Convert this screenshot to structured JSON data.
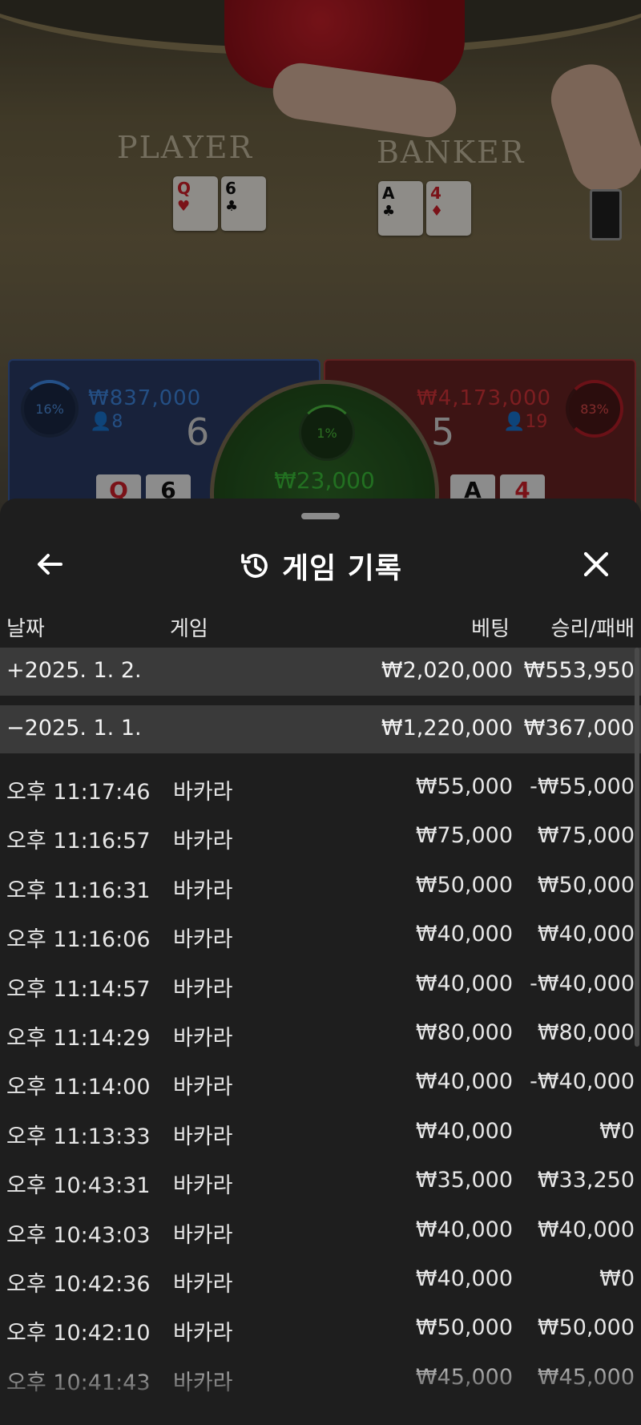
{
  "stage": {
    "player_label": "PLAYER",
    "banker_label": "BANKER",
    "player_cards": [
      {
        "rank": "Q",
        "suit": "♥",
        "color": "red"
      },
      {
        "rank": "6",
        "suit": "♣",
        "color": "black"
      }
    ],
    "banker_cards": [
      {
        "rank": "A",
        "suit": "♣",
        "color": "black"
      },
      {
        "rank": "4",
        "suit": "♦",
        "color": "red"
      }
    ],
    "player": {
      "percent": "16%",
      "amount": "₩837,000",
      "count": "8",
      "score": "6",
      "mini": [
        "Q",
        "6"
      ]
    },
    "banker": {
      "percent": "83%",
      "amount": "₩4,173,000",
      "count": "19",
      "score": "5",
      "mini": [
        "A",
        "4"
      ]
    },
    "tie": {
      "percent": "1%",
      "amount": "₩23,000"
    },
    "colors": {
      "player": "#3e8be8",
      "banker": "#d82a32",
      "tie": "#3cc23a"
    }
  },
  "sheet": {
    "title": "게임 기록",
    "title_icon": "history-icon",
    "back_icon": "arrow-left-icon",
    "close_icon": "close-icon",
    "columns": {
      "date": "날짜",
      "game": "게임",
      "bet": "베팅",
      "result": "승리/패배"
    },
    "days": [
      {
        "label": "+2025. 1. 2.",
        "bet": "₩2,020,000",
        "result": "₩553,950"
      },
      {
        "label": "−2025. 1. 1.",
        "bet": "₩1,220,000",
        "result": "₩367,000"
      }
    ],
    "rows": [
      {
        "time": "오후 11:17:46",
        "game": "바카라",
        "bet": "₩55,000",
        "result": "-₩55,000"
      },
      {
        "time": "오후 11:16:57",
        "game": "바카라",
        "bet": "₩75,000",
        "result": "₩75,000"
      },
      {
        "time": "오후 11:16:31",
        "game": "바카라",
        "bet": "₩50,000",
        "result": "₩50,000"
      },
      {
        "time": "오후 11:16:06",
        "game": "바카라",
        "bet": "₩40,000",
        "result": "₩40,000"
      },
      {
        "time": "오후 11:14:57",
        "game": "바카라",
        "bet": "₩40,000",
        "result": "-₩40,000"
      },
      {
        "time": "오후 11:14:29",
        "game": "바카라",
        "bet": "₩80,000",
        "result": "₩80,000"
      },
      {
        "time": "오후 11:14:00",
        "game": "바카라",
        "bet": "₩40,000",
        "result": "-₩40,000"
      },
      {
        "time": "오후 11:13:33",
        "game": "바카라",
        "bet": "₩40,000",
        "result": "₩0"
      },
      {
        "time": "오후 10:43:31",
        "game": "바카라",
        "bet": "₩35,000",
        "result": "₩33,250"
      },
      {
        "time": "오후 10:43:03",
        "game": "바카라",
        "bet": "₩40,000",
        "result": "₩40,000"
      },
      {
        "time": "오후 10:42:36",
        "game": "바카라",
        "bet": "₩40,000",
        "result": "₩0"
      },
      {
        "time": "오후 10:42:10",
        "game": "바카라",
        "bet": "₩50,000",
        "result": "₩50,000"
      },
      {
        "time": "오후 10:41:43",
        "game": "바카라",
        "bet": "₩45,000",
        "result": "₩45,000"
      }
    ]
  }
}
